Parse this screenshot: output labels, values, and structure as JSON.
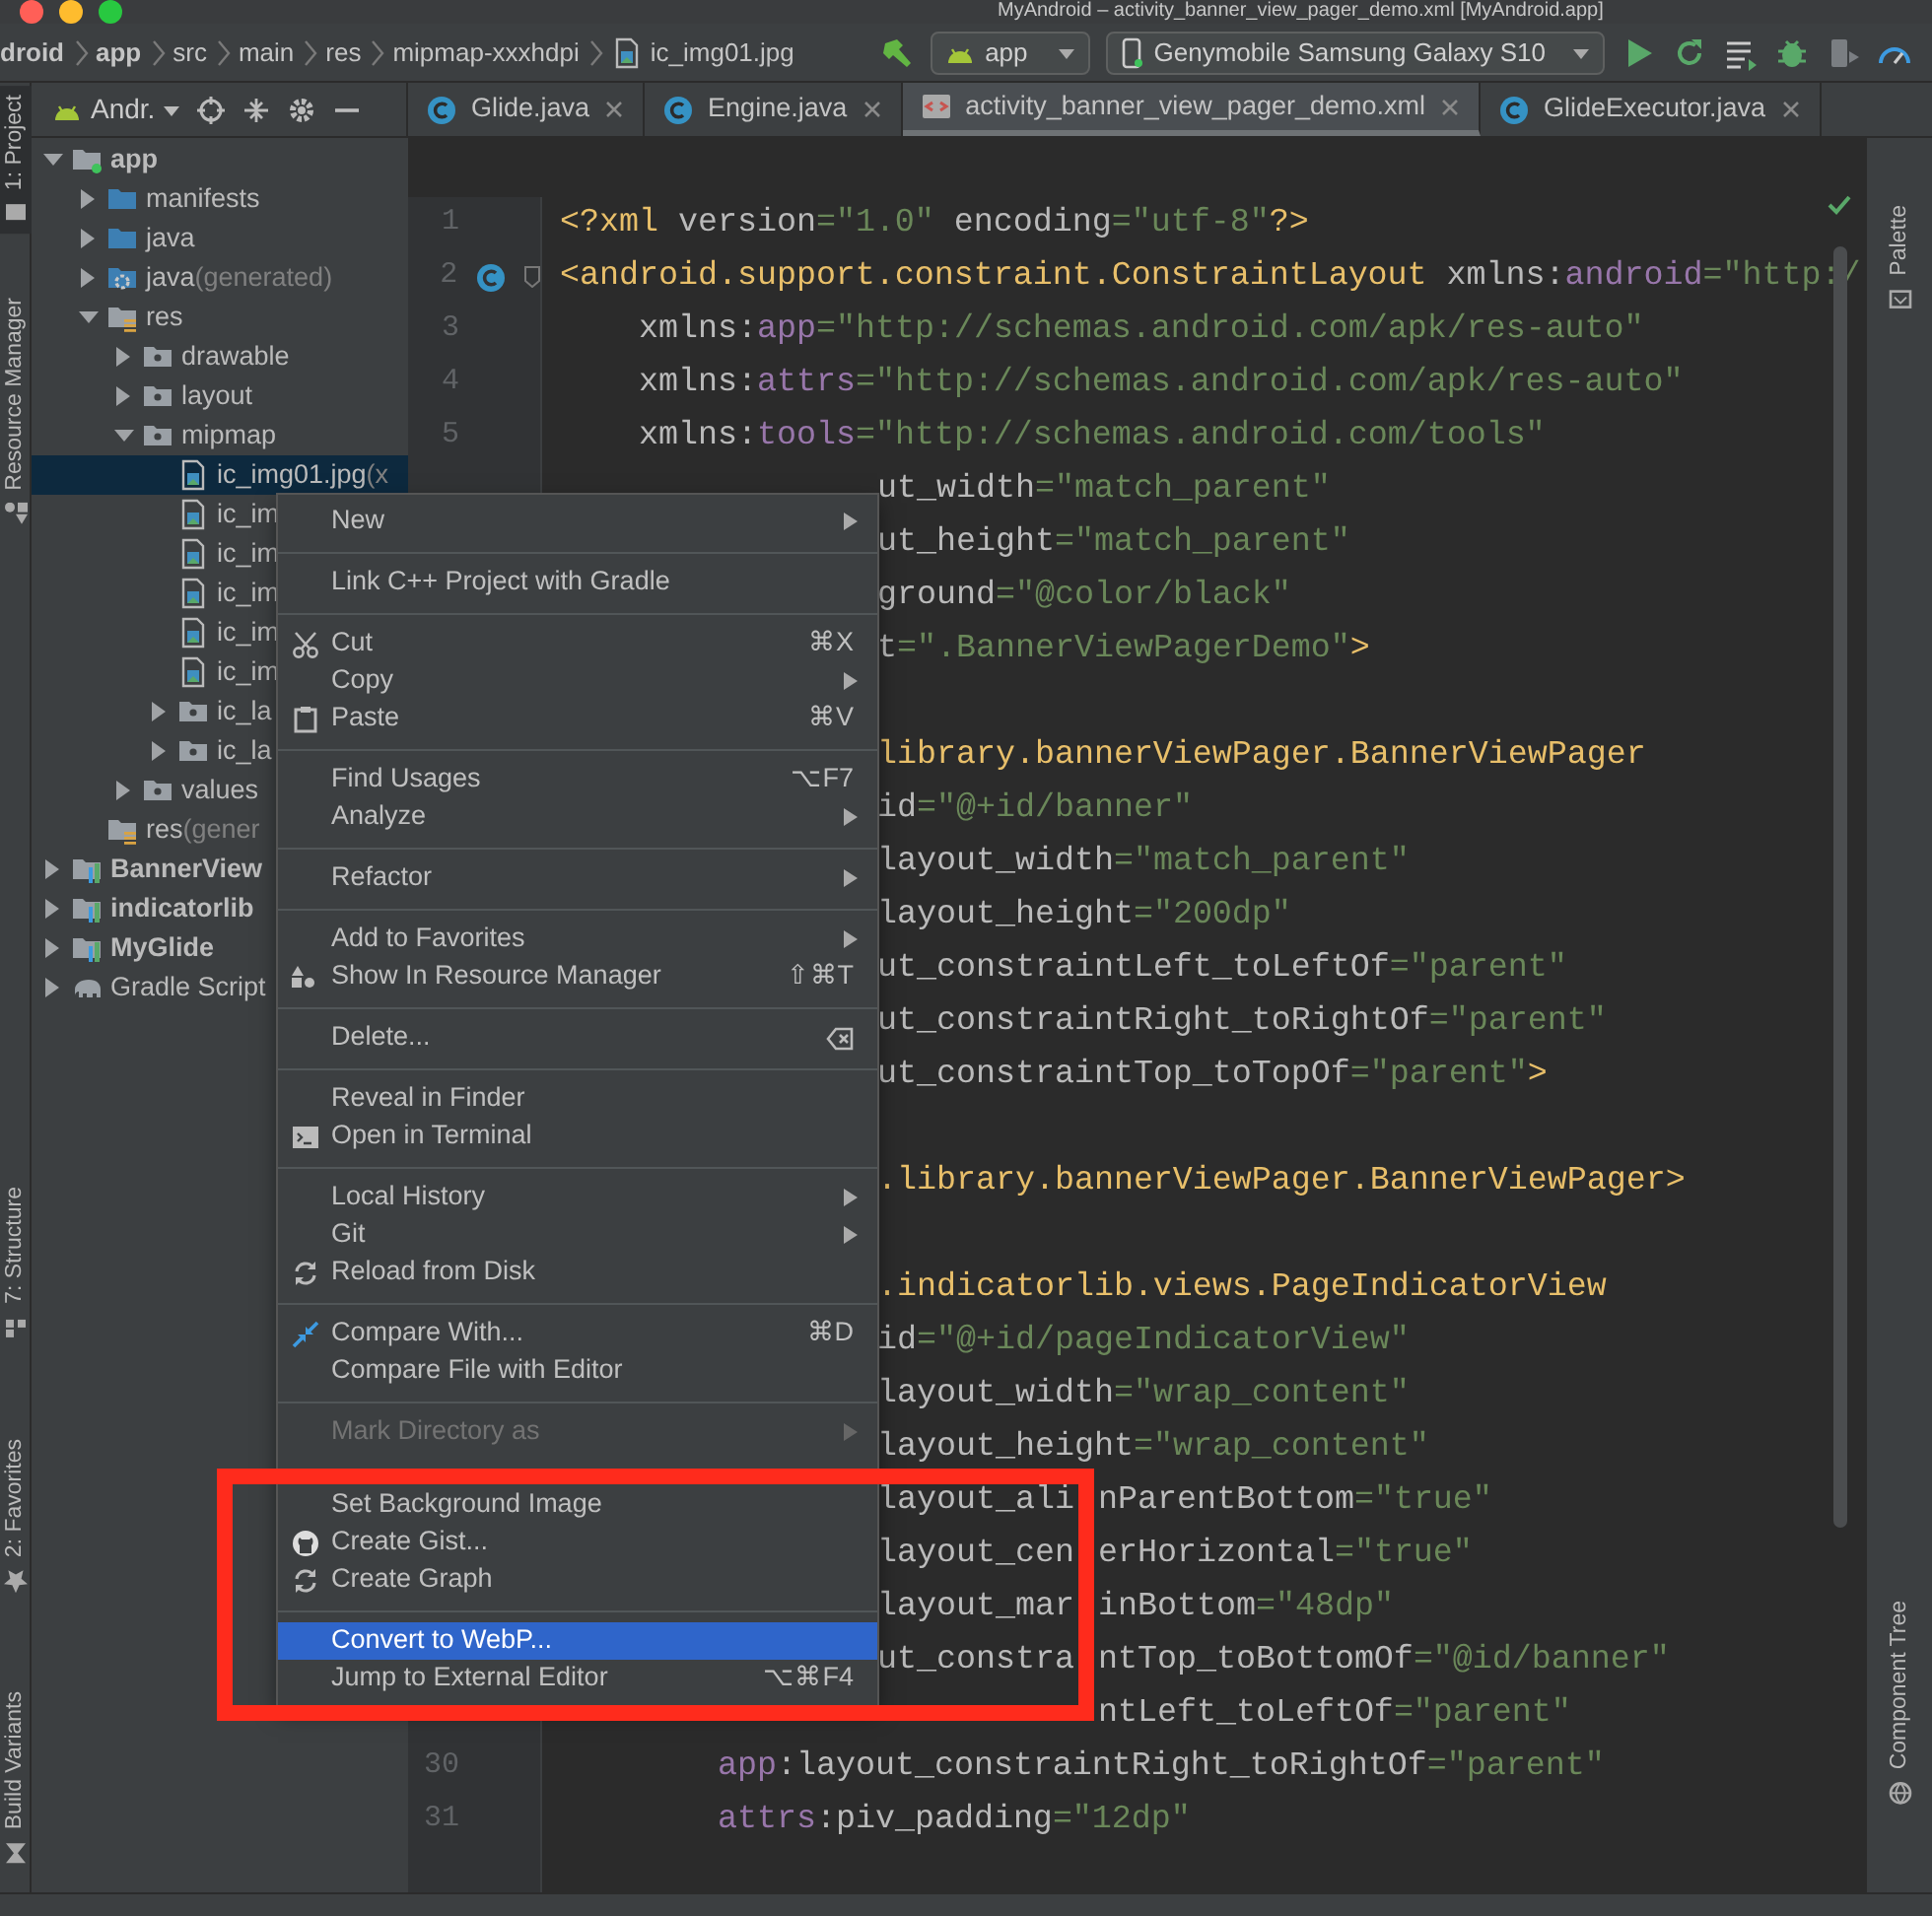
{
  "window": {
    "title": "MyAndroid – activity_banner_view_pager_demo.xml [MyAndroid.app]"
  },
  "breadcrumbs": [
    {
      "label": "droid",
      "kind": "project"
    },
    {
      "label": "app",
      "kind": "module"
    },
    {
      "label": "src",
      "kind": "folder"
    },
    {
      "label": "main",
      "kind": "folder"
    },
    {
      "label": "res",
      "kind": "folder"
    },
    {
      "label": "mipmap-xxxhdpi",
      "kind": "folder"
    },
    {
      "label": "ic_img01.jpg",
      "kind": "image-file"
    }
  ],
  "run_toolbar": {
    "configuration": "app",
    "device": "Genymobile Samsung Galaxy S10"
  },
  "left_tool_windows": {
    "top": [
      {
        "label": "1: Project",
        "kind": "project",
        "selected": true
      },
      {
        "label": "Resource Manager",
        "kind": "resources",
        "selected": false
      }
    ],
    "bottom": [
      {
        "label": "7: Structure",
        "kind": "structure",
        "selected": false
      },
      {
        "label": "2: Favorites",
        "kind": "favorites",
        "selected": false
      },
      {
        "label": "Build Variants",
        "kind": "variants",
        "selected": false
      }
    ]
  },
  "right_tool_windows": {
    "top": [
      {
        "label": "Palette",
        "kind": "palette",
        "selected": false
      }
    ],
    "bottom": [
      {
        "label": "Component Tree",
        "kind": "tree",
        "selected": false
      }
    ]
  },
  "project_panel": {
    "view": "Andr."
  },
  "editor_tabs": [
    {
      "label": "Glide.java",
      "kind": "class",
      "selected": false
    },
    {
      "label": "Engine.java",
      "kind": "class",
      "selected": false
    },
    {
      "label": "activity_banner_view_pager_demo.xml",
      "kind": "layout",
      "selected": true
    },
    {
      "label": "GlideExecutor.java",
      "kind": "class",
      "selected": false
    }
  ],
  "tree": [
    {
      "label": "app",
      "kind": "app-module",
      "expanded": true,
      "selected": false,
      "children": [
        {
          "label": "manifests",
          "kind": "folder",
          "expanded": false,
          "selected": false
        },
        {
          "label": "java",
          "kind": "folder",
          "expanded": false,
          "selected": false
        },
        {
          "label": "java",
          "note": "(generated)",
          "kind": "generated-folder",
          "expanded": false,
          "selected": false
        },
        {
          "label": "res",
          "kind": "res-folder",
          "expanded": true,
          "selected": false,
          "children": [
            {
              "label": "drawable",
              "kind": "res-subfolder",
              "expanded": false,
              "selected": false
            },
            {
              "label": "layout",
              "kind": "res-subfolder",
              "expanded": false,
              "selected": false
            },
            {
              "label": "mipmap",
              "kind": "res-subfolder",
              "expanded": true,
              "selected": false,
              "children": [
                {
                  "label": "ic_img01.jpg",
                  "note": "(x",
                  "kind": "image-file",
                  "selected": true
                },
                {
                  "label": "ic_im",
                  "kind": "image-file",
                  "selected": false
                },
                {
                  "label": "ic_im",
                  "kind": "image-file",
                  "selected": false
                },
                {
                  "label": "ic_im",
                  "kind": "image-file",
                  "selected": false
                },
                {
                  "label": "ic_im",
                  "kind": "image-file",
                  "selected": false
                },
                {
                  "label": "ic_im",
                  "kind": "image-file",
                  "selected": false
                },
                {
                  "label": "ic_la",
                  "kind": "res-subfolder",
                  "expanded": false,
                  "selected": false
                },
                {
                  "label": "ic_la",
                  "kind": "res-subfolder",
                  "expanded": false,
                  "selected": false
                }
              ]
            },
            {
              "label": "values",
              "kind": "res-subfolder",
              "expanded": false,
              "selected": false
            }
          ]
        },
        {
          "label": "res",
          "note": "(gener",
          "kind": "res-folder",
          "selected": false
        }
      ]
    },
    {
      "label": "BannerView",
      "kind": "library-module",
      "expanded": false,
      "selected": false
    },
    {
      "label": "indicatorlib",
      "kind": "library-module",
      "expanded": false,
      "selected": false
    },
    {
      "label": "MyGlide",
      "kind": "library-module",
      "expanded": false,
      "selected": false
    },
    {
      "label": "Gradle Script",
      "kind": "gradle",
      "expanded": false,
      "selected": false
    }
  ],
  "editor": {
    "lines": [
      {
        "number": "1",
        "kind": "top",
        "segments": [
          [
            {
              "kind": "tag",
              "text": "<?xml"
            },
            {
              "kind": "attr",
              "text": " version"
            },
            {
              "kind": "value",
              "text": "=\"1.0\""
            },
            {
              "kind": "attr",
              "text": " encoding"
            },
            {
              "kind": "value",
              "text": "=\"utf-8\""
            },
            {
              "kind": "tag",
              "text": "?>"
            }
          ]
        ]
      },
      {
        "number": "2",
        "kind": "top",
        "class_marker": true,
        "segments": [
          [
            {
              "kind": "tag",
              "text": "<android.support.constraint.ConstraintLayout"
            },
            {
              "kind": "attr",
              "text": " xmlns:"
            },
            {
              "kind": "ns",
              "text": "android"
            },
            {
              "kind": "value",
              "text": "=\"http:/"
            }
          ]
        ]
      },
      {
        "number": "3",
        "kind": "attribute",
        "segments": [
          [
            {
              "kind": "attr",
              "text": "xmlns:"
            },
            {
              "kind": "ns",
              "text": "app"
            },
            {
              "kind": "value",
              "text": "=\"http://schemas.android.com/apk/res-auto\""
            }
          ]
        ]
      },
      {
        "number": "4",
        "kind": "attribute",
        "segments": [
          [
            {
              "kind": "attr",
              "text": "xmlns:"
            },
            {
              "kind": "ns",
              "text": "attrs"
            },
            {
              "kind": "value",
              "text": "=\"http://schemas.android.com/apk/res-auto\""
            }
          ]
        ]
      },
      {
        "number": "5",
        "kind": "attribute",
        "segments": [
          [
            {
              "kind": "attr",
              "text": "xmlns:"
            },
            {
              "kind": "ns",
              "text": "tools"
            },
            {
              "kind": "value",
              "text": "=\"http://schemas.android.com/tools\""
            }
          ]
        ]
      },
      {
        "kind": "behind-menu",
        "segments": [
          [
            {
              "kind": "attr",
              "text": "ut_width"
            },
            {
              "kind": "value",
              "text": "=\"match_parent\""
            }
          ]
        ]
      },
      {
        "kind": "behind-menu",
        "segments": [
          [
            {
              "kind": "attr",
              "text": "ut_height"
            },
            {
              "kind": "value",
              "text": "=\"match_parent\""
            }
          ]
        ]
      },
      {
        "kind": "behind-menu",
        "segments": [
          [
            {
              "kind": "attr",
              "text": "ground"
            },
            {
              "kind": "value",
              "text": "=\"@color/black\""
            }
          ]
        ]
      },
      {
        "kind": "behind-menu",
        "segments": [
          [
            {
              "kind": "attr",
              "text": "t"
            },
            {
              "kind": "value",
              "text": "=\".BannerViewPagerDemo\""
            },
            {
              "kind": "tag",
              "text": ">"
            }
          ]
        ]
      },
      {
        "kind": "blank"
      },
      {
        "kind": "behind-menu",
        "segments": [
          [
            {
              "kind": "tag",
              "text": "library.bannerViewPager.BannerViewPager"
            }
          ]
        ]
      },
      {
        "kind": "behind-menu",
        "segments": [
          [
            {
              "kind": "attr",
              "text": "id"
            },
            {
              "kind": "value",
              "text": "=\"@+id/banner\""
            }
          ]
        ]
      },
      {
        "kind": "behind-menu",
        "segments": [
          [
            {
              "kind": "attr",
              "text": "layout_width"
            },
            {
              "kind": "value",
              "text": "=\"match_parent\""
            }
          ]
        ]
      },
      {
        "kind": "behind-menu",
        "segments": [
          [
            {
              "kind": "attr",
              "text": "layout_height"
            },
            {
              "kind": "value",
              "text": "=\"200dp\""
            }
          ]
        ]
      },
      {
        "kind": "behind-menu",
        "segments": [
          [
            {
              "kind": "attr",
              "text": "ut_constraintLeft_toLeftOf"
            },
            {
              "kind": "value",
              "text": "=\"parent\""
            }
          ]
        ]
      },
      {
        "kind": "behind-menu",
        "segments": [
          [
            {
              "kind": "attr",
              "text": "ut_constraintRight_toRightOf"
            },
            {
              "kind": "value",
              "text": "=\"parent\""
            }
          ]
        ]
      },
      {
        "kind": "behind-menu",
        "segments": [
          [
            {
              "kind": "attr",
              "text": "ut_constraintTop_toTopOf"
            },
            {
              "kind": "value",
              "text": "=\"parent\""
            },
            {
              "kind": "tag",
              "text": ">"
            }
          ]
        ]
      },
      {
        "kind": "blank"
      },
      {
        "kind": "behind-menu",
        "segments": [
          [
            {
              "kind": "tag",
              "text": ".library.bannerViewPager.BannerViewPager>"
            }
          ]
        ]
      },
      {
        "kind": "blank"
      },
      {
        "kind": "behind-menu",
        "segments": [
          [
            {
              "kind": "tag",
              "text": ".indicatorlib.views.PageIndicatorView"
            }
          ]
        ]
      },
      {
        "kind": "behind-menu",
        "segments": [
          [
            {
              "kind": "attr",
              "text": "id"
            },
            {
              "kind": "value",
              "text": "=\"@+id/pageIndicatorView\""
            }
          ]
        ]
      },
      {
        "kind": "behind-menu",
        "segments": [
          [
            {
              "kind": "attr",
              "text": "layout_width"
            },
            {
              "kind": "value",
              "text": "=\"wrap_content\""
            }
          ]
        ]
      },
      {
        "kind": "behind-menu",
        "segments": [
          [
            {
              "kind": "attr",
              "text": "layout_height"
            },
            {
              "kind": "value",
              "text": "=\"wrap_content\""
            }
          ]
        ]
      },
      {
        "kind": "behind-menu",
        "segments": [
          [
            {
              "kind": "attr",
              "text": "layout_ali"
            }
          ],
          [
            {
              "kind": "attr",
              "text": "nParentBottom"
            },
            {
              "kind": "value",
              "text": "=\"true\""
            }
          ]
        ]
      },
      {
        "kind": "behind-menu",
        "segments": [
          [
            {
              "kind": "attr",
              "text": "layout_cen"
            }
          ],
          [
            {
              "kind": "attr",
              "text": "erHorizontal"
            },
            {
              "kind": "value",
              "text": "=\"true\""
            }
          ]
        ]
      },
      {
        "kind": "behind-menu",
        "segments": [
          [
            {
              "kind": "attr",
              "text": "layout_mar"
            }
          ],
          [
            {
              "kind": "attr",
              "text": "inBottom"
            },
            {
              "kind": "value",
              "text": "=\"48dp\""
            }
          ]
        ]
      },
      {
        "kind": "behind-menu",
        "segments": [
          [
            {
              "kind": "attr",
              "text": "ut_constra"
            }
          ],
          [
            {
              "kind": "attr",
              "text": "ntTop_toBottomOf"
            },
            {
              "kind": "value",
              "text": "=\"@id/banner\""
            }
          ]
        ]
      },
      {
        "kind": "behind-frame",
        "segments": [
          [
            {
              "kind": "attr",
              "text": "ntLeft_toLeftOf"
            },
            {
              "kind": "value",
              "text": "=\"parent\""
            }
          ]
        ]
      },
      {
        "number": "30",
        "kind": "nested",
        "segments": [
          [
            {
              "kind": "ns",
              "text": "app"
            },
            {
              "kind": "attr",
              "text": ":layout_constraintRight_toRightOf"
            },
            {
              "kind": "value",
              "text": "=\"parent\""
            }
          ]
        ]
      },
      {
        "number": "31",
        "kind": "nested",
        "segments": [
          [
            {
              "kind": "ns",
              "text": "attrs"
            },
            {
              "kind": "attr",
              "text": ":piv_padding"
            },
            {
              "kind": "value",
              "text": "=\"12dp\""
            }
          ]
        ]
      }
    ]
  },
  "context_menu": {
    "groups": [
      {
        "framed": false,
        "items": [
          {
            "label": "New",
            "kind": "plain",
            "submenu": true,
            "disabled": false,
            "selected": false
          }
        ]
      },
      {
        "framed": false,
        "items": [
          {
            "label": "Link C++ Project with Gradle",
            "kind": "plain",
            "submenu": false,
            "disabled": false,
            "selected": false
          }
        ]
      },
      {
        "framed": false,
        "items": [
          {
            "label": "Cut",
            "kind": "cut",
            "shortcut": "⌘X",
            "submenu": false,
            "disabled": false,
            "selected": false
          },
          {
            "label": "Copy",
            "kind": "plain",
            "submenu": true,
            "disabled": false,
            "selected": false
          },
          {
            "label": "Paste",
            "kind": "paste",
            "shortcut": "⌘V",
            "submenu": false,
            "disabled": false,
            "selected": false
          }
        ]
      },
      {
        "framed": false,
        "items": [
          {
            "label": "Find Usages",
            "kind": "plain",
            "shortcut": "⌥F7",
            "submenu": false,
            "disabled": false,
            "selected": false
          },
          {
            "label": "Analyze",
            "kind": "plain",
            "submenu": true,
            "disabled": false,
            "selected": false
          }
        ]
      },
      {
        "framed": false,
        "items": [
          {
            "label": "Refactor",
            "kind": "plain",
            "submenu": true,
            "disabled": false,
            "selected": false
          }
        ]
      },
      {
        "framed": false,
        "items": [
          {
            "label": "Add to Favorites",
            "kind": "plain",
            "submenu": true,
            "disabled": false,
            "selected": false
          },
          {
            "label": "Show In Resource Manager",
            "kind": "resources",
            "shortcut": "⇧⌘T",
            "submenu": false,
            "disabled": false,
            "selected": false
          }
        ]
      },
      {
        "framed": false,
        "items": [
          {
            "label": "Delete...",
            "kind": "delete",
            "submenu": false,
            "disabled": false,
            "selected": false
          }
        ]
      },
      {
        "framed": false,
        "items": [
          {
            "label": "Reveal in Finder",
            "kind": "plain",
            "submenu": false,
            "disabled": false,
            "selected": false
          },
          {
            "label": "Open in Terminal",
            "kind": "terminal",
            "submenu": false,
            "disabled": false,
            "selected": false
          }
        ]
      },
      {
        "framed": false,
        "items": [
          {
            "label": "Local History",
            "kind": "plain",
            "submenu": true,
            "disabled": false,
            "selected": false
          },
          {
            "label": "Git",
            "kind": "plain",
            "submenu": true,
            "disabled": false,
            "selected": false
          },
          {
            "label": "Reload from Disk",
            "kind": "reload",
            "submenu": false,
            "disabled": false,
            "selected": false
          }
        ]
      },
      {
        "framed": false,
        "items": [
          {
            "label": "Compare With...",
            "kind": "compare",
            "shortcut": "⌘D",
            "submenu": false,
            "disabled": false,
            "selected": false
          },
          {
            "label": "Compare File with Editor",
            "kind": "plain",
            "submenu": false,
            "disabled": false,
            "selected": false
          }
        ]
      },
      {
        "framed": false,
        "items": [
          {
            "label": "Mark Directory as",
            "kind": "plain",
            "submenu": true,
            "disabled": true,
            "selected": false
          }
        ]
      },
      {
        "framed": true,
        "items": [
          {
            "label": "Set Background Image",
            "kind": "plain",
            "submenu": false,
            "disabled": false,
            "selected": false
          },
          {
            "label": "Create Gist...",
            "kind": "gist",
            "submenu": false,
            "disabled": false,
            "selected": false
          },
          {
            "label": "Create Graph",
            "kind": "reload",
            "submenu": false,
            "disabled": false,
            "selected": false
          }
        ]
      },
      {
        "framed": true,
        "items": [
          {
            "label": "Convert to WebP...",
            "kind": "plain",
            "submenu": false,
            "disabled": false,
            "selected": true
          },
          {
            "label": "Jump to External Editor",
            "kind": "plain",
            "shortcut": "⌥⌘F4",
            "submenu": false,
            "disabled": false,
            "selected": false
          }
        ]
      }
    ]
  }
}
